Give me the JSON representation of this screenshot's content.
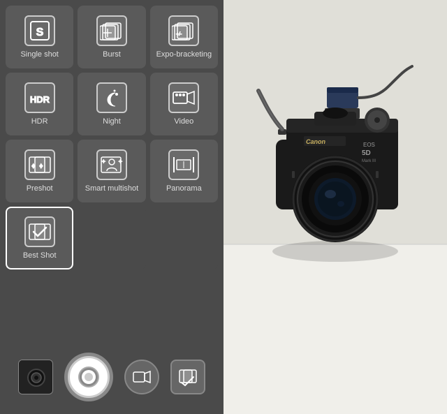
{
  "modes": [
    {
      "id": "single-shot",
      "label": "Single shot",
      "icon": "S",
      "type": "letter",
      "selected": false
    },
    {
      "id": "burst",
      "label": "Burst",
      "icon": "burst",
      "type": "burst",
      "selected": false
    },
    {
      "id": "expo-bracketing",
      "label": "Expo-bracketing",
      "icon": "expo",
      "type": "expo",
      "selected": false
    },
    {
      "id": "hdr",
      "label": "HDR",
      "icon": "HDR",
      "type": "letter",
      "selected": false
    },
    {
      "id": "night",
      "label": "Night",
      "icon": "night",
      "type": "night",
      "selected": false
    },
    {
      "id": "video",
      "label": "Video",
      "icon": "video",
      "type": "video",
      "selected": false
    },
    {
      "id": "preshot",
      "label": "Preshot",
      "icon": "preshot",
      "type": "preshot",
      "selected": false
    },
    {
      "id": "smart-multishot",
      "label": "Smart multishot",
      "icon": "smart",
      "type": "smart",
      "selected": false
    },
    {
      "id": "panorama",
      "label": "Panorama",
      "icon": "panorama",
      "type": "panorama",
      "selected": false
    },
    {
      "id": "best-shot",
      "label": "Best Shot",
      "icon": "bestshot",
      "type": "bestshot",
      "selected": true
    },
    {
      "id": "empty1",
      "label": "",
      "icon": "",
      "type": "empty",
      "selected": false
    },
    {
      "id": "empty2",
      "label": "",
      "icon": "",
      "type": "empty",
      "selected": false
    }
  ],
  "bottomBar": {
    "captureLabel": "Capture",
    "videoLabel": "Video mode",
    "galleryLabel": "Gallery"
  }
}
